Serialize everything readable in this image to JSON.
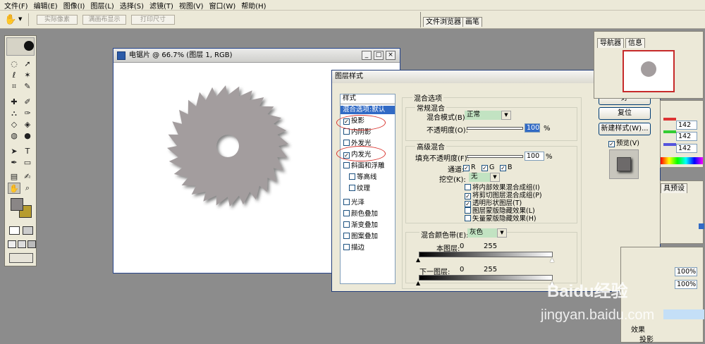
{
  "menu": [
    "文件(F)",
    "编辑(E)",
    "图像(I)",
    "图层(L)",
    "选择(S)",
    "滤镜(T)",
    "视图(V)",
    "窗口(W)",
    "帮助(H)"
  ],
  "options": {
    "btn1": "实际像素",
    "btn2": "满画布显示",
    "btn3": "打印尺寸"
  },
  "top_tabs": [
    "文件浏览器",
    "画笔"
  ],
  "document": {
    "title": "电锯片 @ 66.7% (图层 1, RGB)"
  },
  "dialog": {
    "title": "图层样式",
    "styles_header": "样式",
    "styles": [
      {
        "label": "混合选项:默认",
        "check": false,
        "selected": true
      },
      {
        "label": "投影",
        "check": true
      },
      {
        "label": "内阴影",
        "check": true
      },
      {
        "label": "外发光",
        "check": true
      },
      {
        "label": "内发光",
        "check": true
      },
      {
        "label": "斜面和浮雕",
        "check": true
      },
      {
        "label": "等高线",
        "check": true,
        "indent": true
      },
      {
        "label": "纹理",
        "check": true,
        "indent": true
      },
      {
        "label": "光泽",
        "check": true
      },
      {
        "label": "颜色叠加",
        "check": true
      },
      {
        "label": "渐变叠加",
        "check": true
      },
      {
        "label": "图案叠加",
        "check": true
      },
      {
        "label": "描边",
        "check": true
      }
    ],
    "blend_options": "混合选项",
    "general_blend": "常规混合",
    "blend_mode_label": "混合模式(B):",
    "blend_mode_value": "正常",
    "opacity_label": "不透明度(O):",
    "opacity_value": "100",
    "pct": "%",
    "advanced_blend": "高级混合",
    "fill_opacity_label": "填充不透明度(F):",
    "fill_opacity_value": "100",
    "channels_label": "通道:",
    "ch_r": "R",
    "ch_g": "G",
    "ch_b": "B",
    "knockout_label": "挖空(K):",
    "knockout_value": "无",
    "opts": [
      "将内部效果混合成组(I)",
      "将剪切图层混合成组(P)",
      "透明形状图层(T)",
      "图层蒙版隐藏效果(L)",
      "矢量蒙版隐藏效果(H)"
    ],
    "blend_if_label": "混合颜色带(E):",
    "blend_if_value": "灰色",
    "this_layer_label": "本图层:",
    "this_layer_min": "0",
    "this_layer_max": "255",
    "underlying_label": "下一图层:",
    "underlying_min": "0",
    "underlying_max": "255",
    "ok": "好",
    "reset": "复位",
    "new_style": "新建样式(W)...",
    "preview": "预览(V)"
  },
  "right": {
    "nav_tabs": [
      "导航器",
      "信息"
    ],
    "color_values": [
      "142",
      "142",
      "142"
    ],
    "tab_partial": "具预设",
    "pct1": "100%",
    "pct2": "100%",
    "layers_effects": "效果",
    "layers_shadow": "投影"
  },
  "watermark": {
    "brand": "Baidu经验",
    "url": "jingyan.baidu.com"
  }
}
